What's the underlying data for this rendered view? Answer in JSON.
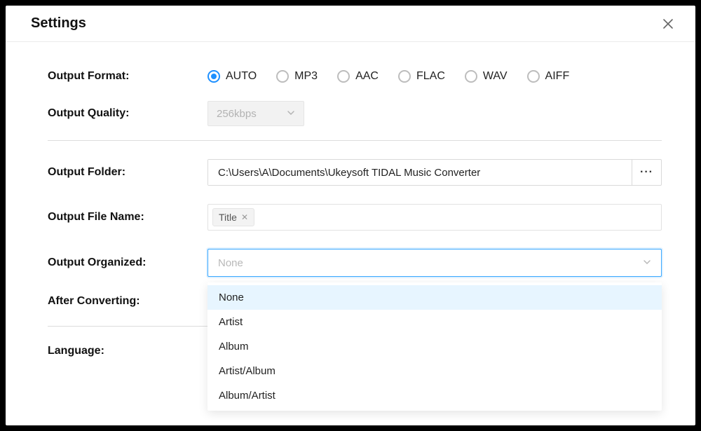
{
  "title": "Settings",
  "labels": {
    "output_format": "Output Format:",
    "output_quality": "Output Quality:",
    "output_folder": "Output Folder:",
    "output_filename": "Output File Name:",
    "output_organized": "Output Organized:",
    "after_converting": "After Converting:",
    "language": "Language:"
  },
  "format": {
    "options": [
      "AUTO",
      "MP3",
      "AAC",
      "FLAC",
      "WAV",
      "AIFF"
    ],
    "selected": "AUTO"
  },
  "quality": {
    "value": "256kbps",
    "disabled": true
  },
  "folder": {
    "path": "C:\\Users\\A\\Documents\\Ukeysoft TIDAL Music Converter",
    "browse_label": "···"
  },
  "filename": {
    "tags": [
      "Title"
    ]
  },
  "organized": {
    "placeholder": "None",
    "open": true,
    "options": [
      "None",
      "Artist",
      "Album",
      "Artist/Album",
      "Album/Artist"
    ],
    "highlighted": "None"
  }
}
